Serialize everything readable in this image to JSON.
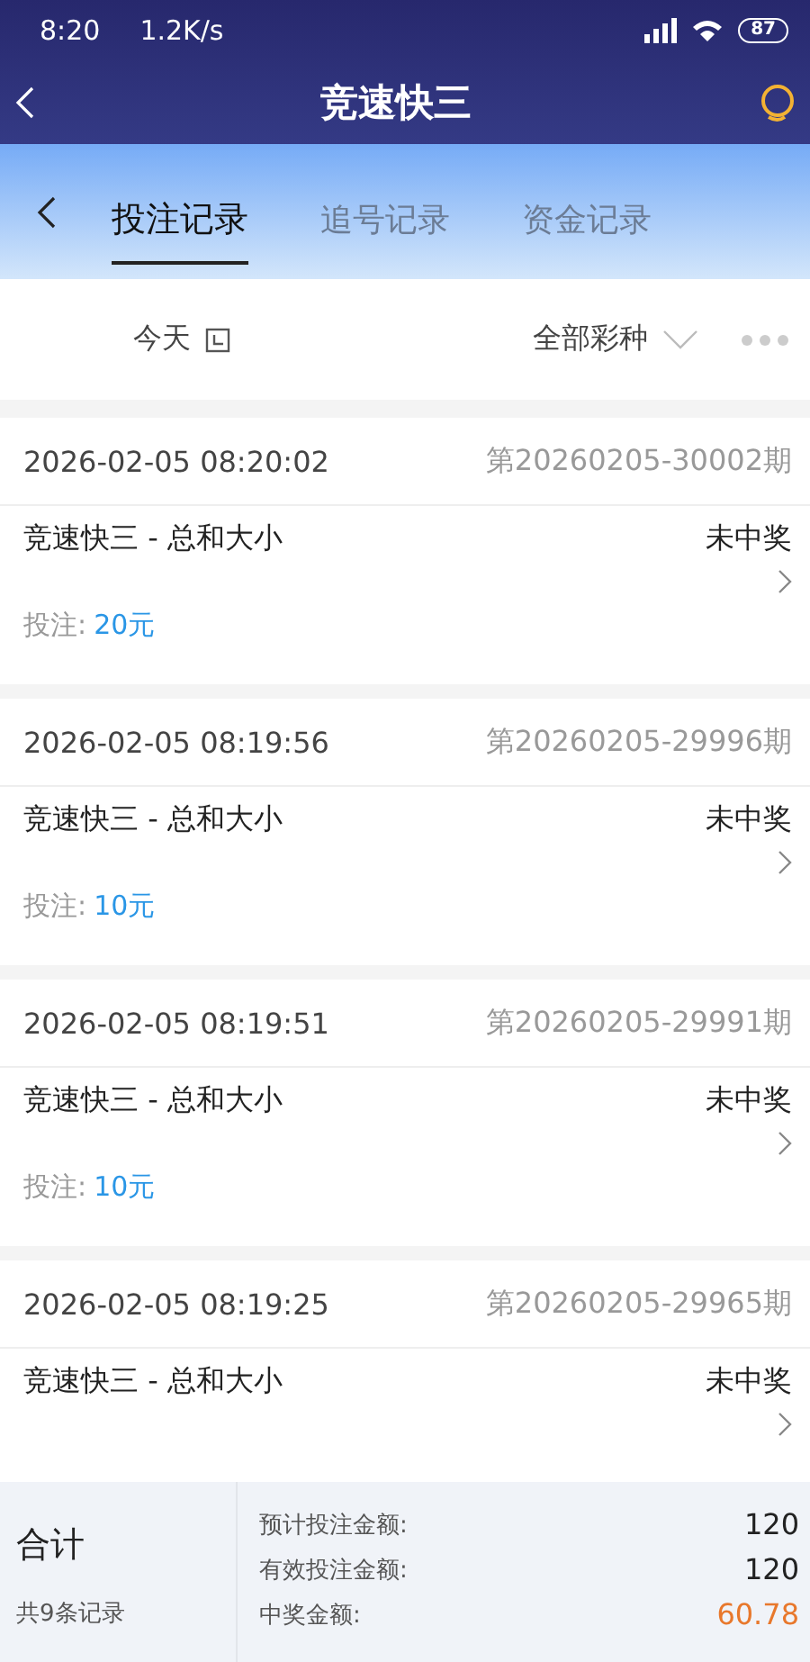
{
  "status_bar": {
    "time": "8:20",
    "speed": "1.2K/s",
    "battery": "87"
  },
  "header": {
    "title": "竞速快三"
  },
  "tabs": [
    {
      "label": "投注记录",
      "selected": true
    },
    {
      "label": "追号记录",
      "selected": false
    },
    {
      "label": "资金记录",
      "selected": false
    }
  ],
  "filters": {
    "date": "今天",
    "lottery": "全部彩种"
  },
  "records": [
    {
      "time": "2026-02-05 08:20:02",
      "issue": "第20260205-30002期",
      "game": "竞速快三 - 总和大小",
      "result": "未中奖",
      "stake_label": "投注:",
      "stake": "20元"
    },
    {
      "time": "2026-02-05 08:19:56",
      "issue": "第20260205-29996期",
      "game": "竞速快三 - 总和大小",
      "result": "未中奖",
      "stake_label": "投注:",
      "stake": "10元"
    },
    {
      "time": "2026-02-05 08:19:51",
      "issue": "第20260205-29991期",
      "game": "竞速快三 - 总和大小",
      "result": "未中奖",
      "stake_label": "投注:",
      "stake": "10元"
    },
    {
      "time": "2026-02-05 08:19:25",
      "issue": "第20260205-29965期",
      "game": "竞速快三 - 总和大小",
      "result": "未中奖"
    }
  ],
  "summary": {
    "title": "合计",
    "count": "共9条记录",
    "rows": [
      {
        "label": "预计投注金额:",
        "value": "120",
        "kind": "plain"
      },
      {
        "label": "有效投注金额:",
        "value": "120",
        "kind": "plain"
      },
      {
        "label": "中奖金额:",
        "value": "60.78",
        "kind": "highlight"
      }
    ]
  }
}
